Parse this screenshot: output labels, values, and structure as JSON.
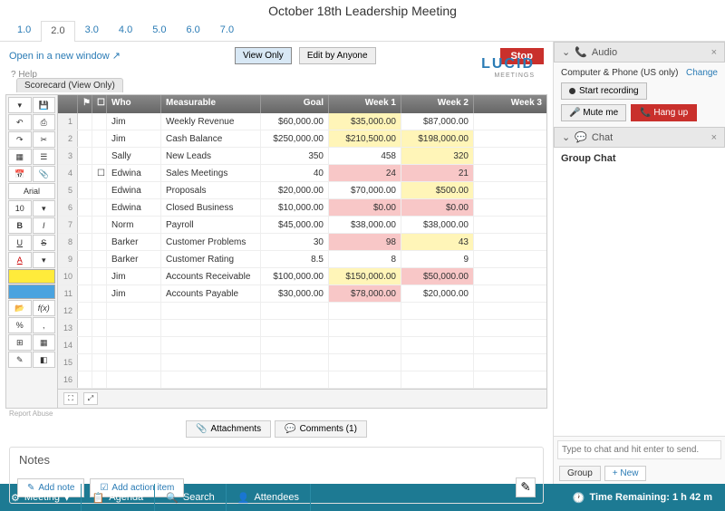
{
  "title": "October 18th Leadership Meeting",
  "tabs": [
    "1.0",
    "2.0",
    "3.0",
    "4.0",
    "5.0",
    "6.0",
    "7.0"
  ],
  "active_tab": "2.0",
  "open_new": "Open in a new window",
  "view_only": "View Only",
  "edit_anyone": "Edit by Anyone",
  "stop": "Stop",
  "help": "?  Help",
  "logo_sub": "MEETINGS",
  "scorecard": "Scorecard (View Only)",
  "font": "Arial",
  "font_size": "10",
  "columns": {
    "who": "Who",
    "measurable": "Measurable",
    "goal": "Goal",
    "w1": "Week 1",
    "w2": "Week 2",
    "w3": "Week 3"
  },
  "rows": [
    {
      "n": "1",
      "who": "Jim",
      "meas": "Weekly Revenue",
      "goal": "$60,000.00",
      "w1": "$35,000.00",
      "w2": "$87,000.00",
      "w1c": "hl-yellow"
    },
    {
      "n": "2",
      "who": "Jim",
      "meas": "Cash Balance",
      "goal": "$250,000.00",
      "w1": "$210,500.00",
      "w2": "$198,000.00",
      "w1c": "hl-yellow",
      "w2c": "hl-yellow"
    },
    {
      "n": "3",
      "who": "Sally",
      "meas": "New Leads",
      "goal": "350",
      "w1": "458",
      "w2": "320",
      "w2c": "hl-yellow"
    },
    {
      "n": "4",
      "who": "Edwina",
      "meas": "Sales Meetings",
      "goal": "40",
      "w1": "24",
      "w2": "21",
      "w1c": "hl-pink",
      "w2c": "hl-pink",
      "rowc": "",
      "chk": true
    },
    {
      "n": "5",
      "who": "Edwina",
      "meas": "Proposals",
      "goal": "$20,000.00",
      "w1": "$70,000.00",
      "w2": "$500.00",
      "w2c": "hl-yellow"
    },
    {
      "n": "6",
      "who": "Edwina",
      "meas": "Closed Business",
      "goal": "$10,000.00",
      "w1": "$0.00",
      "w2": "$0.00",
      "w1c": "hl-pink",
      "w2c": "hl-pink"
    },
    {
      "n": "7",
      "who": "Norm",
      "meas": "Payroll",
      "goal": "$45,000.00",
      "w1": "$38,000.00",
      "w2": "$38,000.00"
    },
    {
      "n": "8",
      "who": "Barker",
      "meas": "Customer Problems",
      "goal": "30",
      "w1": "98",
      "w2": "43",
      "w1c": "hl-pink",
      "w2c": "hl-yellow"
    },
    {
      "n": "9",
      "who": "Barker",
      "meas": "Customer Rating",
      "goal": "8.5",
      "w1": "8",
      "w2": "9"
    },
    {
      "n": "10",
      "who": "Jim",
      "meas": "Accounts Receivable",
      "goal": "$100,000.00",
      "w1": "$150,000.00",
      "w2": "$50,000.00",
      "w1c": "hl-yellow",
      "w2c": "hl-pink"
    },
    {
      "n": "11",
      "who": "Jim",
      "meas": "Accounts Payable",
      "goal": "$30,000.00",
      "w1": "$78,000.00",
      "w2": "$20,000.00",
      "w1c": "hl-pink"
    },
    {
      "n": "12"
    },
    {
      "n": "13"
    },
    {
      "n": "14"
    },
    {
      "n": "15"
    },
    {
      "n": "16"
    }
  ],
  "attachments": "Attachments",
  "comments": "Comments  (1)",
  "report": "Report Abuse",
  "notes_head": "Notes",
  "add_note": "Add note",
  "add_action": "Add action item",
  "audio": {
    "title": "Audio",
    "sub": "Computer & Phone (US only)",
    "change": "Change",
    "rec": "Start recording",
    "mute": "Mute me",
    "hang": "Hang up"
  },
  "chat": {
    "title": "Chat",
    "group": "Group Chat",
    "placeholder": "Type to chat and hit enter to send.",
    "tab_group": "Group",
    "tab_new": "+ New"
  },
  "bottom": {
    "meeting": "Meeting",
    "agenda": "Agenda",
    "search": "Search",
    "attendees": "Attendees",
    "time": "Time Remaining: 1 h 42 m"
  }
}
